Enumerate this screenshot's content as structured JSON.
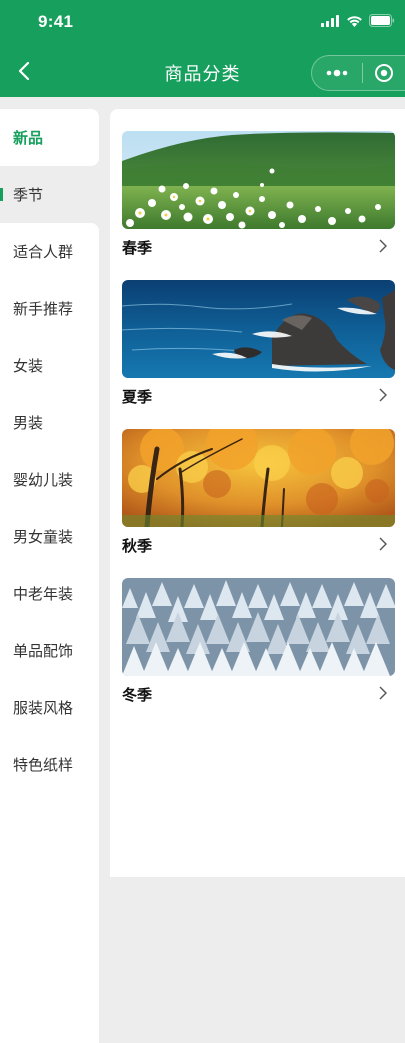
{
  "status_bar": {
    "time": "9:41"
  },
  "nav": {
    "title": "商品分类"
  },
  "sidebar": {
    "items": [
      {
        "label": "新品"
      },
      {
        "label": "季节"
      },
      {
        "label": "适合人群"
      },
      {
        "label": "新手推荐"
      },
      {
        "label": "女装"
      },
      {
        "label": "男装"
      },
      {
        "label": "婴幼儿装"
      },
      {
        "label": "男女童装"
      },
      {
        "label": "中老年装"
      },
      {
        "label": "单品配饰"
      },
      {
        "label": "服装风格"
      },
      {
        "label": "特色纸样"
      }
    ]
  },
  "categories": [
    {
      "label": "春季",
      "image": "spring-meadow-flowers"
    },
    {
      "label": "夏季",
      "image": "summer-sea-rocks"
    },
    {
      "label": "秋季",
      "image": "autumn-golden-trees"
    },
    {
      "label": "冬季",
      "image": "winter-snowy-forest"
    }
  ],
  "colors": {
    "brand": "#17a05d",
    "background": "#ededed"
  }
}
